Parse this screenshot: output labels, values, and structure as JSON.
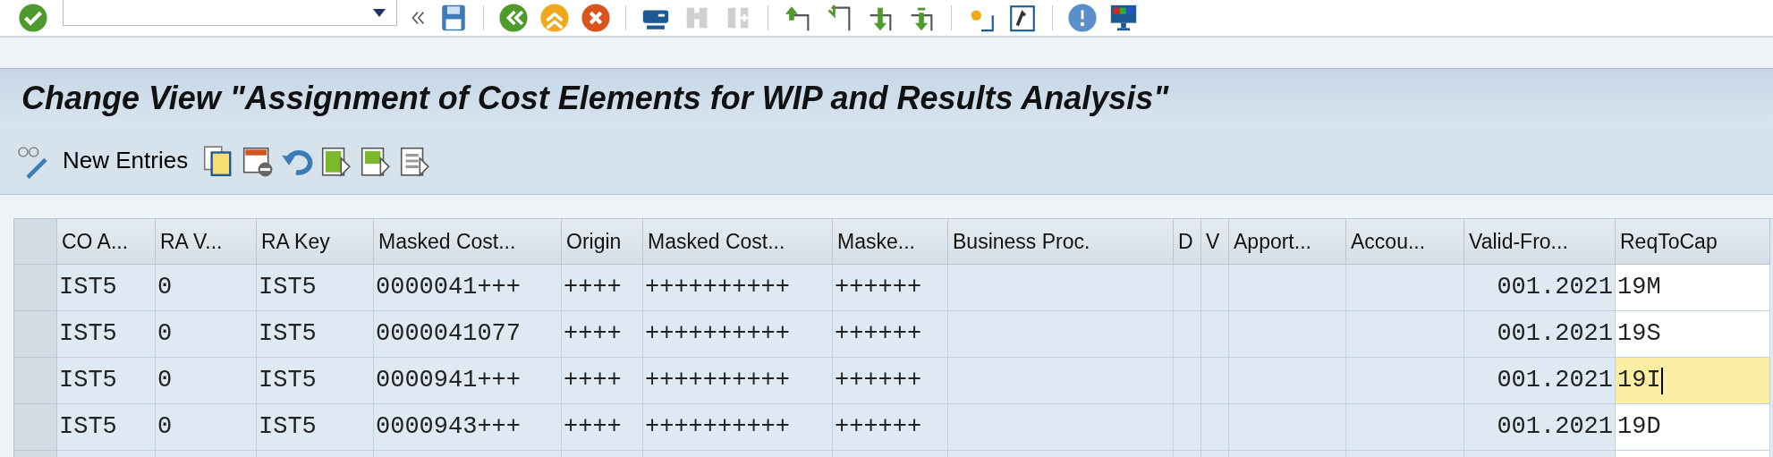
{
  "title": "Change View \"Assignment of Cost Elements for WIP and Results Analysis\"",
  "app_toolbar": {
    "new_entries": "New Entries"
  },
  "table": {
    "columns": [
      {
        "label": "CO A...",
        "editable": false
      },
      {
        "label": "RA V...",
        "editable": false
      },
      {
        "label": "RA Key",
        "editable": false
      },
      {
        "label": "Masked Cost...",
        "editable": false
      },
      {
        "label": "Origin",
        "editable": false
      },
      {
        "label": "Masked Cost...",
        "editable": false
      },
      {
        "label": "Maske...",
        "editable": false
      },
      {
        "label": "Business Proc.",
        "editable": false
      },
      {
        "label": "D",
        "editable": false
      },
      {
        "label": "V",
        "editable": false
      },
      {
        "label": "Apport...",
        "editable": false
      },
      {
        "label": "Accou...",
        "editable": false
      },
      {
        "label": "Valid-Fro...",
        "editable": false
      },
      {
        "label": "ReqToCap",
        "editable": true
      }
    ],
    "rows": [
      {
        "editing": false,
        "cells": [
          "IST5",
          "0",
          "IST5",
          "0000041+++",
          "++++",
          "++++++++++",
          "++++++",
          null,
          null,
          null,
          null,
          null,
          "001.2021",
          "19M"
        ]
      },
      {
        "editing": false,
        "cells": [
          "IST5",
          "0",
          "IST5",
          "0000041077",
          "++++",
          "++++++++++",
          "++++++",
          null,
          null,
          null,
          null,
          null,
          "001.2021",
          "19S"
        ]
      },
      {
        "editing": true,
        "cells": [
          "IST5",
          "0",
          "IST5",
          "0000941+++",
          "++++",
          "++++++++++",
          "++++++",
          null,
          null,
          null,
          null,
          null,
          "001.2021",
          "19I"
        ]
      },
      {
        "editing": false,
        "cells": [
          "IST5",
          "0",
          "IST5",
          "0000943+++",
          "++++",
          "++++++++++",
          "++++++",
          null,
          null,
          null,
          null,
          null,
          "001.2021",
          "19D"
        ]
      }
    ]
  }
}
